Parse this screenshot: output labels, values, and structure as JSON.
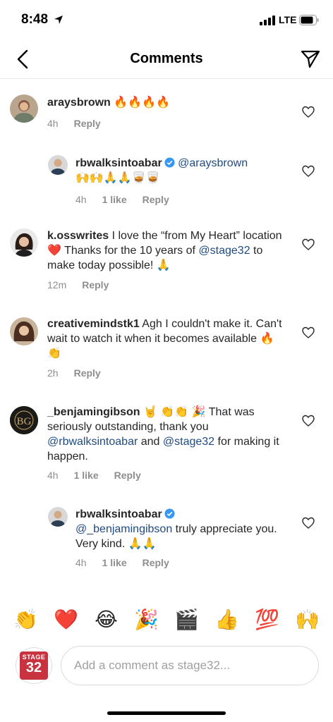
{
  "status_bar": {
    "time": "8:48",
    "network": "LTE"
  },
  "header": {
    "title": "Comments"
  },
  "comments": [
    {
      "username": "araysbrown",
      "text": " 🔥🔥🔥🔥",
      "time": "4h",
      "reply": "Reply"
    },
    {
      "username": "rbwalksintoabar",
      "mention": "@araysbrown",
      "text": "🙌🙌🙏🙏🥃🥃",
      "time": "4h",
      "likes": "1 like",
      "reply": "Reply"
    },
    {
      "username": "k.osswrites",
      "text_a": " I love the “from My Heart” location ❤️ Thanks for the 10 years of ",
      "mention": "@stage32",
      "text_b": " to make today possible! 🙏",
      "time": "12m",
      "reply": "Reply"
    },
    {
      "username": "creativemindstk1",
      "text": " Agh I couldn't make it. Can't wait to watch it when it becomes available 🔥 👏",
      "time": "2h",
      "reply": "Reply"
    },
    {
      "username": "_benjamingibson",
      "text_a": " 🤘 👏👏 🎉 That was seriously outstanding, thank you ",
      "mention_a": "@rbwalksintoabar",
      "text_b": " and ",
      "mention_b": "@stage32",
      "text_c": " for making it happen.",
      "time": "4h",
      "likes": "1 like",
      "reply": "Reply"
    },
    {
      "username": "rbwalksintoabar",
      "mention": "@_benjamingibson",
      "text": " truly appreciate you.  Very kind. 🙏🙏",
      "time": "4h",
      "likes": "1 like",
      "reply": "Reply"
    }
  ],
  "emoji_bar": [
    "👏",
    "❤️",
    "😂",
    "🎉",
    "🎬",
    "👍",
    "💯",
    "🙌"
  ],
  "composer": {
    "placeholder": "Add a comment as stage32...",
    "logo_top": "STAGE",
    "logo_num": "32"
  },
  "colors": {
    "mention": "#1e4b82",
    "verified": "#3897f0",
    "brand": "#c9333f"
  }
}
